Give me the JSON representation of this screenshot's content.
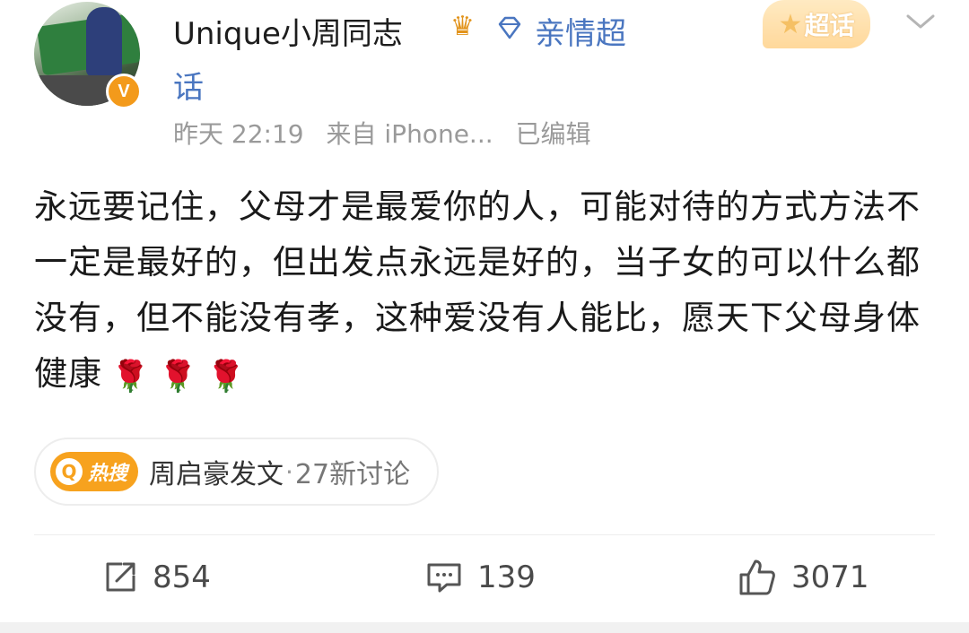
{
  "post": {
    "username": "Unique小周同志",
    "fan_group_line1": "亲情超",
    "fan_group_line2": "话",
    "verified_badge": "V",
    "supertopic_badge": "超话",
    "timestamp": "昨天 22:19",
    "source": "来自 iPhone...",
    "edited": "已编辑",
    "content": "永远要记住，父母才是最爱你的人，可能对待的方式方法不一定是最好的，但出发点永远是好的，当子女的可以什么都没有，但不能没有孝，这种爱没有人能比，愿天下父母身体健康",
    "emoji": [
      "🌹",
      "🌹",
      "🌹"
    ]
  },
  "hot_tag": {
    "badge": "热搜",
    "topic": "周启豪发文",
    "separator": "·",
    "discussion": "27新讨论"
  },
  "actions": {
    "repost_count": "854",
    "comment_count": "139",
    "like_count": "3071"
  },
  "icons": [
    "crown-icon",
    "diamond-icon",
    "chevron-down-icon",
    "rose-icon",
    "search-icon",
    "repost-icon",
    "comment-icon",
    "like-icon"
  ],
  "colors": {
    "link_blue": "#4a76c0",
    "hot_orange": "#f7a21e",
    "meta_gray": "#9a9a9a"
  }
}
